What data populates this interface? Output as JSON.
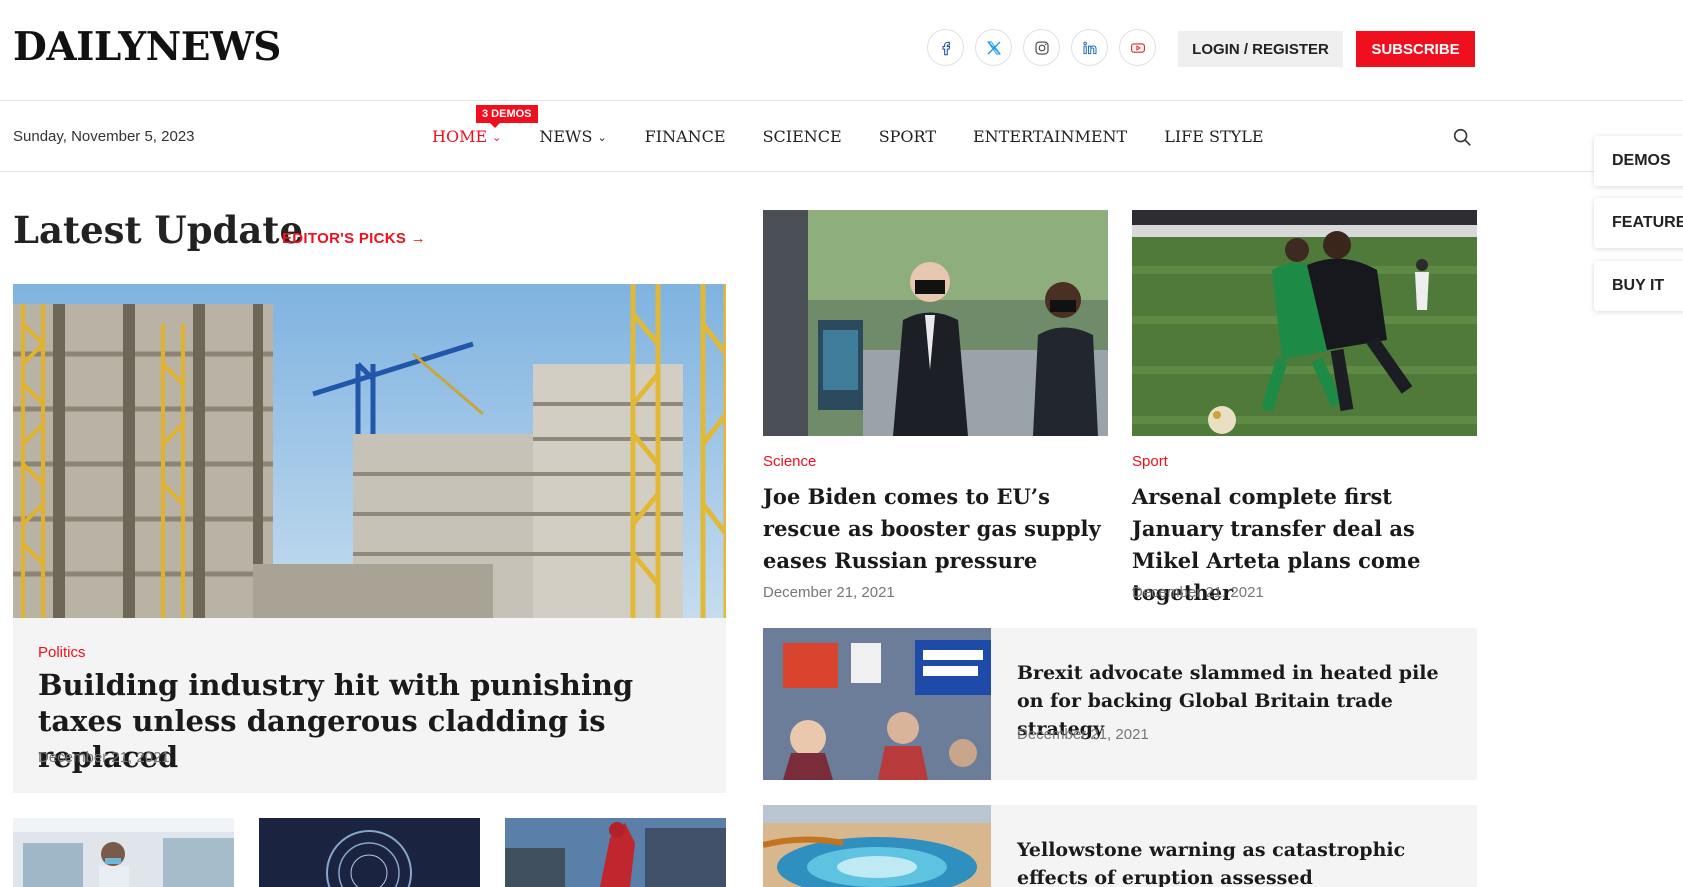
{
  "header": {
    "logo": "DAILYNEWS",
    "socials": [
      {
        "icon": "facebook-icon"
      },
      {
        "icon": "x-twitter-icon"
      },
      {
        "icon": "instagram-icon"
      },
      {
        "icon": "linkedin-icon"
      },
      {
        "icon": "youtube-icon"
      }
    ],
    "login_label": "LOGIN / REGISTER",
    "subscribe_label": "SUBSCRIBE"
  },
  "navbar": {
    "date": "Sunday, November 5, 2023",
    "badge": "3 DEMOS",
    "items": [
      {
        "label": "HOME",
        "dropdown": true,
        "active": true
      },
      {
        "label": "NEWS",
        "dropdown": true,
        "active": false
      },
      {
        "label": "FINANCE",
        "dropdown": false,
        "active": false
      },
      {
        "label": "SCIENCE",
        "dropdown": false,
        "active": false
      },
      {
        "label": "SPORT",
        "dropdown": false,
        "active": false
      },
      {
        "label": "ENTERTAINMENT",
        "dropdown": false,
        "active": false
      },
      {
        "label": "LIFE STYLE",
        "dropdown": false,
        "active": false
      }
    ],
    "search_icon": "search-icon"
  },
  "side_tabs": [
    "DEMOS",
    "FEATURES",
    "BUY IT"
  ],
  "section": {
    "title": "Latest Update",
    "editors_link": "EDITOR'S PICKS →"
  },
  "feature": {
    "category": "Politics",
    "title": "Building industry hit with punishing taxes unless dangerous cladding is replaced",
    "date": "December 21, 2021"
  },
  "columns": [
    {
      "category": "Science",
      "title": "Joe Biden comes to EU’s rescue as booster gas supply eases Russian pressure",
      "date": "December 21, 2021"
    },
    {
      "category": "Sport",
      "title": "Arsenal complete first January transfer deal as Mikel Arteta plans come together",
      "date": "December 21, 2021"
    }
  ],
  "list": [
    {
      "title": "Brexit advocate slammed in heated pile on for backing Global Britain trade strategy",
      "date": "December 21, 2021"
    },
    {
      "title": "Yellowstone warning as catastrophic effects of eruption assessed",
      "date": ""
    }
  ],
  "colors": {
    "accent": "#f00f1f",
    "card_bg": "#f4f4f4",
    "text": "#1a1a1a",
    "muted": "#777777"
  }
}
